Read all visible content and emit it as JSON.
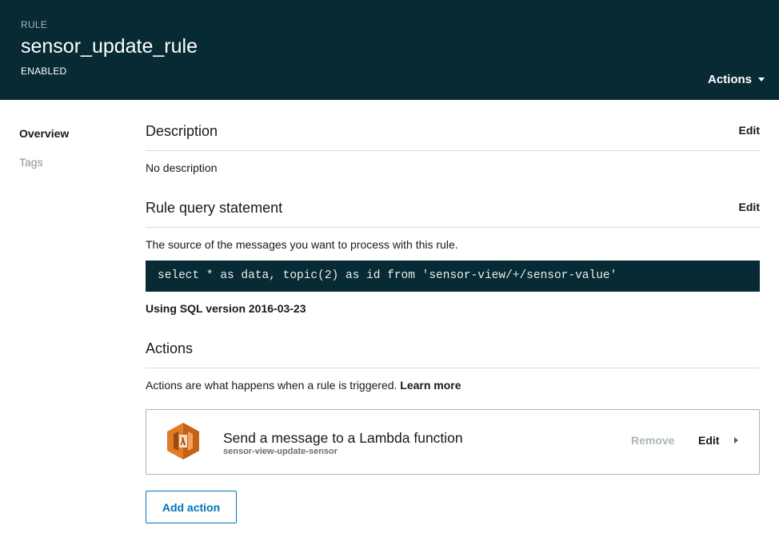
{
  "header": {
    "kicker": "RULE",
    "title": "sensor_update_rule",
    "status": "ENABLED",
    "actions_label": "Actions"
  },
  "sidenav": {
    "items": [
      {
        "label": "Overview",
        "active": true
      },
      {
        "label": "Tags",
        "active": false
      }
    ]
  },
  "description": {
    "title": "Description",
    "edit_label": "Edit",
    "text": "No description"
  },
  "rule_query": {
    "title": "Rule query statement",
    "edit_label": "Edit",
    "intro": "The source of the messages you want to process with this rule.",
    "sql": "select * as data, topic(2) as id from 'sensor-view/+/sensor-value'",
    "sql_version": "Using SQL version 2016-03-23"
  },
  "actions_section": {
    "title": "Actions",
    "intro": "Actions are what happens when a rule is triggered.",
    "learn_more": "Learn more",
    "items": [
      {
        "title": "Send a message to a Lambda function",
        "subtitle": "sensor-view-update-sensor",
        "icon": "lambda-icon",
        "remove_label": "Remove",
        "edit_label": "Edit"
      }
    ],
    "add_label": "Add action"
  },
  "colors": {
    "header_bg": "#072a35",
    "accent_blue": "#0073bb",
    "lambda_orange": "#e07b28"
  }
}
